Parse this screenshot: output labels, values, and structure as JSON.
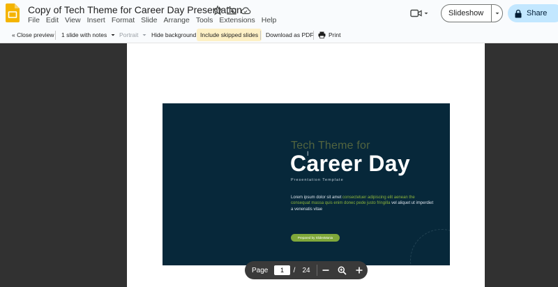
{
  "app": {
    "title": "Copy of Tech Theme for Career Day Presentation",
    "menu": [
      "File",
      "Edit",
      "View",
      "Insert",
      "Format",
      "Slide",
      "Arrange",
      "Tools",
      "Extensions",
      "Help"
    ],
    "slideshow_label": "Slideshow",
    "share_label": "Share",
    "colors": {
      "accent": "#c2e7ff",
      "logo": "#f4b400"
    }
  },
  "toolbar": {
    "close_preview": "« Close preview",
    "layout": "1 slide with notes",
    "orientation": "Portrait",
    "hide_background": "Hide background",
    "include_skipped": "Include skipped slides",
    "download_pdf": "Download as PDF",
    "print": "Print"
  },
  "slide": {
    "subtitle": "Tech Theme for",
    "title": "Career Day",
    "tagline": "Presentation Template",
    "body_1": "Lorem ipsum dolor sit amet ",
    "body_hl_1": "consectetuer adipiscing elit aenean the consequat massa quis enim donec pede justo fringilla",
    "body_2": " vel  aliquet ut imperdiet a venenatis vitae",
    "button": "Prepared by SlidesMania",
    "colors": {
      "background": "#07283a",
      "accent": "#8db53b"
    }
  },
  "pager": {
    "label": "Page",
    "current": "1",
    "separator": "/",
    "total": "24"
  }
}
